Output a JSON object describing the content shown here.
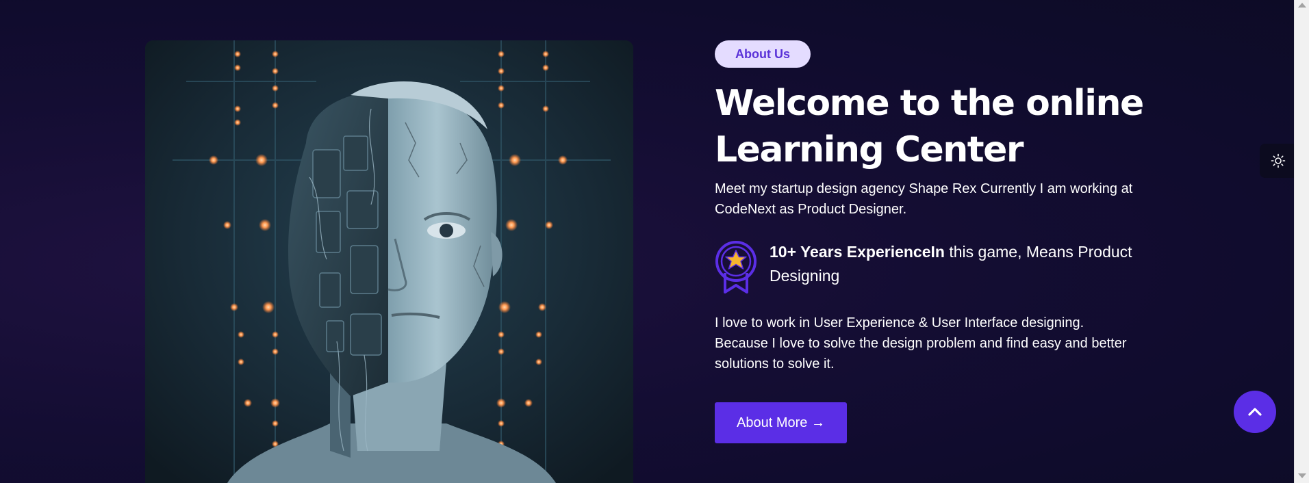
{
  "about": {
    "badge_label": "About Us",
    "headline_line1": "Welcome to the online",
    "headline_line2": "Learning Center",
    "intro": "Meet my startup design agency Shape Rex Currently I am working at CodeNext as Product Designer.",
    "experience_strong": "10+ Years ExperienceIn",
    "experience_rest": " this game, Means Product Designing",
    "body": "I love to work in User Experience & User Interface designing. Because I love to solve the design problem and find easy and better solutions to solve it.",
    "cta_label": "About More →"
  },
  "icons": {
    "medal": "medal-star-icon",
    "theme_toggle": "sun-icon",
    "scroll_top": "chevron-up-icon"
  },
  "colors": {
    "accent": "#5b2ee6",
    "badge_bg": "#e4dcff",
    "badge_text": "#5a32d8",
    "medal_gold": "#f5b52e",
    "background": "#130d33"
  }
}
